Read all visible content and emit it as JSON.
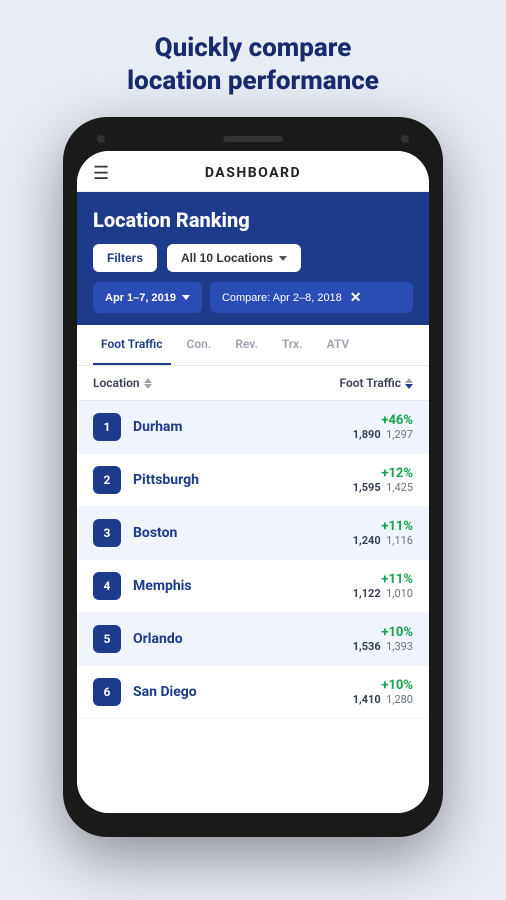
{
  "page": {
    "headline_line1": "Quickly compare",
    "headline_line2": "location performance"
  },
  "topbar": {
    "title": "DASHBOARD",
    "menu_icon": "☰"
  },
  "ranking": {
    "title": "Location Ranking",
    "filter_btn": "Filters",
    "locations_btn": "All 10 Locations",
    "date_range": "Apr 1–7, 2019",
    "compare_label": "Compare: Apr 2–8, 2018"
  },
  "tabs": [
    {
      "id": "foot-traffic",
      "label": "Foot Traffic",
      "active": true
    },
    {
      "id": "con",
      "label": "Con.",
      "active": false
    },
    {
      "id": "rev",
      "label": "Rev.",
      "active": false
    },
    {
      "id": "trx",
      "label": "Trx.",
      "active": false
    },
    {
      "id": "atv",
      "label": "ATV",
      "active": false
    }
  ],
  "table": {
    "col_location": "Location",
    "col_foot_traffic": "Foot Traffic",
    "rows": [
      {
        "rank": "1",
        "name": "Durham",
        "pct": "+46%",
        "current": "1,890",
        "compare": "1,297"
      },
      {
        "rank": "2",
        "name": "Pittsburgh",
        "pct": "+12%",
        "current": "1,595",
        "compare": "1,425"
      },
      {
        "rank": "3",
        "name": "Boston",
        "pct": "+11%",
        "current": "1,240",
        "compare": "1,116"
      },
      {
        "rank": "4",
        "name": "Memphis",
        "pct": "+11%",
        "current": "1,122",
        "compare": "1,010"
      },
      {
        "rank": "5",
        "name": "Orlando",
        "pct": "+10%",
        "current": "1,536",
        "compare": "1,393"
      },
      {
        "rank": "6",
        "name": "San Diego",
        "pct": "+10%",
        "current": "1,410",
        "compare": "1,280"
      }
    ]
  }
}
